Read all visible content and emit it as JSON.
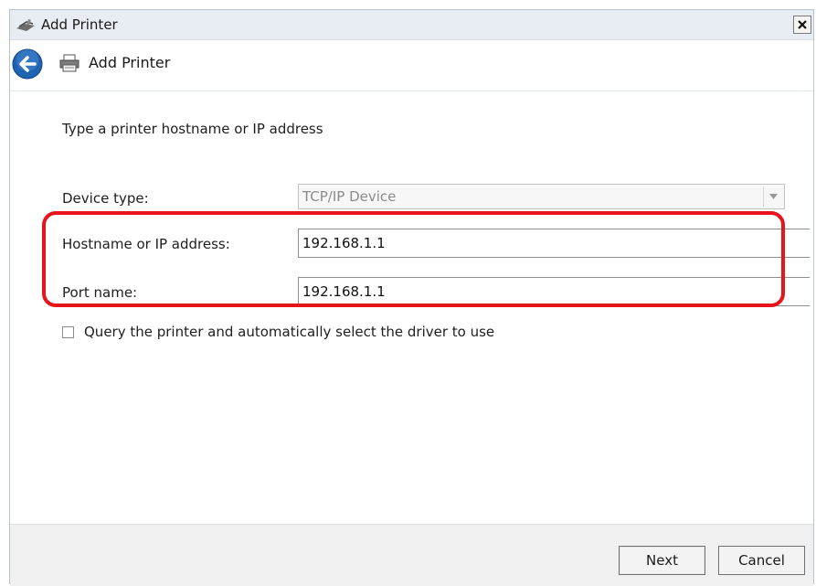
{
  "window": {
    "title": "Add Printer",
    "close_symbol": "x"
  },
  "nav": {
    "title": "Add Printer",
    "back_icon": "back-arrow-icon",
    "printer_icon": "printer-icon"
  },
  "content": {
    "heading": "Type a printer hostname or IP address",
    "device_type": {
      "label": "Device type:",
      "value": "TCP/IP Device"
    },
    "hostname": {
      "label": "Hostname or IP address:",
      "value": "192.168.1.1"
    },
    "port": {
      "label": "Port name:",
      "value": "192.168.1.1"
    },
    "query_checkbox": {
      "label": "Query the printer and automatically select the driver to use",
      "checked": false
    }
  },
  "footer": {
    "next_label": "Next",
    "cancel_label": "Cancel"
  },
  "colors": {
    "highlight": "#e8141b",
    "back_button": "#1f63b2"
  }
}
